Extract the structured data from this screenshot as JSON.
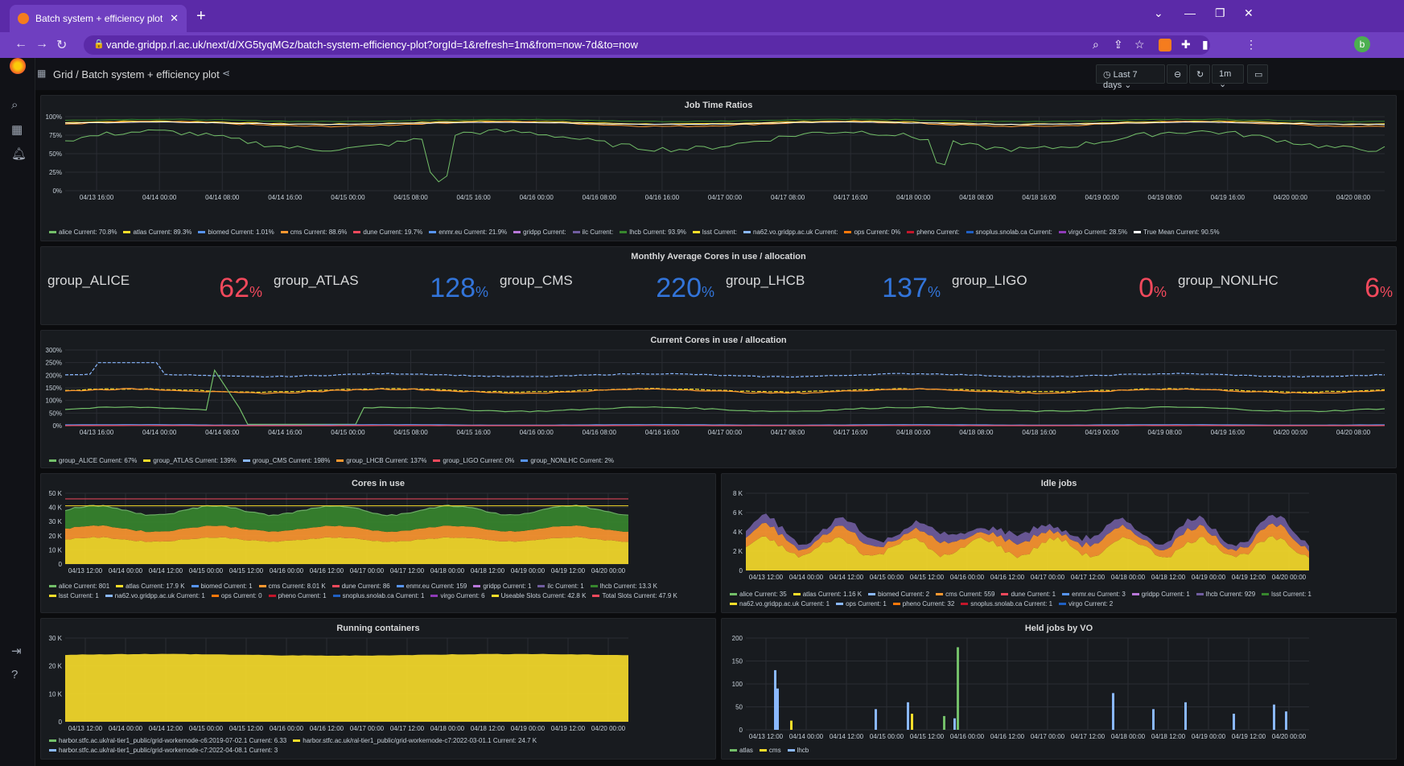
{
  "browser": {
    "tab_title": "Batch system + efficiency plot - G",
    "tab_close": "✕",
    "new_tab": "+",
    "url": "vande.gridpp.rl.ac.uk/next/d/XG5tyqMGz/batch-system-efficiency-plot?orgId=1&refresh=1m&from=now-7d&to=now",
    "profile_initial": "b"
  },
  "header": {
    "breadcrumb": "Grid  /  Batch system + efficiency plot",
    "time_range": "Last 7 days",
    "refresh": "1m"
  },
  "panels": {
    "job_time_ratios": {
      "title": "Job Time Ratios",
      "y_ticks": [
        "100%",
        "75%",
        "50%",
        "25%",
        "0%"
      ],
      "x_ticks": [
        "04/13 16:00",
        "04/14 00:00",
        "04/14 08:00",
        "04/14 16:00",
        "04/15 00:00",
        "04/15 08:00",
        "04/15 16:00",
        "04/16 00:00",
        "04/16 08:00",
        "04/16 16:00",
        "04/17 00:00",
        "04/17 08:00",
        "04/17 16:00",
        "04/18 00:00",
        "04/18 08:00",
        "04/18 16:00",
        "04/19 00:00",
        "04/19 08:00",
        "04/19 16:00",
        "04/20 00:00",
        "04/20 08:00"
      ],
      "legend": [
        {
          "text": "alice  Current: 70.8%",
          "color": "#73bf69"
        },
        {
          "text": "atlas  Current: 89.3%",
          "color": "#fade2a"
        },
        {
          "text": "biomed  Current: 1.01%",
          "color": "#5794f2"
        },
        {
          "text": "cms  Current: 88.6%",
          "color": "#ff9830"
        },
        {
          "text": "dune  Current: 19.7%",
          "color": "#f2495c"
        },
        {
          "text": "enmr.eu  Current: 21.9%",
          "color": "#5794f2"
        },
        {
          "text": "gridpp  Current:",
          "color": "#b877d9"
        },
        {
          "text": "ilc  Current:",
          "color": "#705da0"
        },
        {
          "text": "lhcb  Current: 93.9%",
          "color": "#37872d"
        },
        {
          "text": "lsst  Current:",
          "color": "#fade2a"
        },
        {
          "text": "na62.vo.gridpp.ac.uk  Current:",
          "color": "#8ab8ff"
        },
        {
          "text": "ops  Current: 0%",
          "color": "#ff780a"
        },
        {
          "text": "pheno  Current:",
          "color": "#c4162a"
        },
        {
          "text": "snoplus.snolab.ca  Current:",
          "color": "#1f60c4"
        },
        {
          "text": "virgo  Current: 28.5%",
          "color": "#8f3bb8"
        },
        {
          "text": "True Mean  Current: 90.5%",
          "color": "#ffffff"
        }
      ]
    },
    "monthly_avg": {
      "title": "Monthly Average Cores in use / allocation",
      "stats": [
        {
          "name": "group_ALICE",
          "value": "62",
          "unit": "%",
          "color": "#f2495c"
        },
        {
          "name": "group_ATLAS",
          "value": "128",
          "unit": "%",
          "color": "#3274d9"
        },
        {
          "name": "group_CMS",
          "value": "220",
          "unit": "%",
          "color": "#3274d9"
        },
        {
          "name": "group_LHCB",
          "value": "137",
          "unit": "%",
          "color": "#3274d9"
        },
        {
          "name": "group_LIGO",
          "value": "0",
          "unit": "%",
          "color": "#f2495c"
        },
        {
          "name": "group_NONLHC",
          "value": "6",
          "unit": "%",
          "color": "#f2495c"
        }
      ]
    },
    "current_cores": {
      "title": "Current Cores in use / allocation",
      "y_ticks": [
        "300%",
        "250%",
        "200%",
        "150%",
        "100%",
        "50%",
        "0%"
      ],
      "x_ticks": [
        "04/13 16:00",
        "04/14 00:00",
        "04/14 08:00",
        "04/14 16:00",
        "04/15 00:00",
        "04/15 08:00",
        "04/15 16:00",
        "04/16 00:00",
        "04/16 08:00",
        "04/16 16:00",
        "04/17 00:00",
        "04/17 08:00",
        "04/17 16:00",
        "04/18 00:00",
        "04/18 08:00",
        "04/18 16:00",
        "04/19 00:00",
        "04/19 08:00",
        "04/19 16:00",
        "04/20 00:00",
        "04/20 08:00"
      ],
      "legend": [
        {
          "text": "group_ALICE  Current: 67%",
          "color": "#73bf69"
        },
        {
          "text": "group_ATLAS  Current: 139%",
          "color": "#fade2a"
        },
        {
          "text": "group_CMS  Current: 198%",
          "color": "#8ab8ff"
        },
        {
          "text": "group_LHCB  Current: 137%",
          "color": "#ff9830"
        },
        {
          "text": "group_LIGO  Current: 0%",
          "color": "#f2495c"
        },
        {
          "text": "group_NONLHC  Current: 2%",
          "color": "#5794f2"
        }
      ]
    },
    "cores_in_use": {
      "title": "Cores in use",
      "y_ticks": [
        "50 K",
        "40 K",
        "30 K",
        "20 K",
        "10 K",
        "0"
      ],
      "x_ticks": [
        "04/13 12:00",
        "04/14 00:00",
        "04/14 12:00",
        "04/15 00:00",
        "04/15 12:00",
        "04/16 00:00",
        "04/16 12:00",
        "04/17 00:00",
        "04/17 12:00",
        "04/18 00:00",
        "04/18 12:00",
        "04/19 00:00",
        "04/19 12:00",
        "04/20 00:00"
      ],
      "legend": [
        {
          "text": "alice  Current: 801",
          "color": "#73bf69"
        },
        {
          "text": "atlas  Current: 17.9 K",
          "color": "#fade2a"
        },
        {
          "text": "biomed  Current: 1",
          "color": "#5794f2"
        },
        {
          "text": "cms  Current: 8.01 K",
          "color": "#ff9830"
        },
        {
          "text": "dune  Current: 86",
          "color": "#f2495c"
        },
        {
          "text": "enmr.eu  Current: 159",
          "color": "#5794f2"
        },
        {
          "text": "gridpp  Current: 1",
          "color": "#b877d9"
        },
        {
          "text": "ilc  Current: 1",
          "color": "#705da0"
        },
        {
          "text": "lhcb  Current: 13.3 K",
          "color": "#37872d"
        },
        {
          "text": "lsst  Current: 1",
          "color": "#fade2a"
        },
        {
          "text": "na62.vo.gridpp.ac.uk  Current: 1",
          "color": "#8ab8ff"
        },
        {
          "text": "ops  Current: 0",
          "color": "#ff780a"
        },
        {
          "text": "pheno  Current: 1",
          "color": "#c4162a"
        },
        {
          "text": "snoplus.snolab.ca  Current: 1",
          "color": "#1f60c4"
        },
        {
          "text": "virgo  Current: 6",
          "color": "#8f3bb8"
        },
        {
          "text": "Useable Slots  Current: 42.8 K",
          "color": "#fade2a"
        },
        {
          "text": "Total Slots  Current: 47.9 K",
          "color": "#f2495c"
        }
      ]
    },
    "idle_jobs": {
      "title": "Idle jobs",
      "y_ticks": [
        "8 K",
        "6 K",
        "4 K",
        "2 K",
        "0"
      ],
      "x_ticks": [
        "04/13 12:00",
        "04/14 00:00",
        "04/14 12:00",
        "04/15 00:00",
        "04/15 12:00",
        "04/16 00:00",
        "04/16 12:00",
        "04/17 00:00",
        "04/17 12:00",
        "04/18 00:00",
        "04/18 12:00",
        "04/19 00:00",
        "04/19 12:00",
        "04/20 00:00"
      ],
      "legend": [
        {
          "text": "alice  Current: 35",
          "color": "#73bf69"
        },
        {
          "text": "atlas  Current: 1.16 K",
          "color": "#fade2a"
        },
        {
          "text": "biomed  Current: 2",
          "color": "#8ab8ff"
        },
        {
          "text": "cms  Current: 559",
          "color": "#ff9830"
        },
        {
          "text": "dune  Current: 1",
          "color": "#f2495c"
        },
        {
          "text": "enmr.eu  Current: 3",
          "color": "#5794f2"
        },
        {
          "text": "gridpp  Current: 1",
          "color": "#b877d9"
        },
        {
          "text": "lhcb  Current: 929",
          "color": "#705da0"
        },
        {
          "text": "lsst  Current: 1",
          "color": "#37872d"
        },
        {
          "text": "na62.vo.gridpp.ac.uk  Current: 1",
          "color": "#fade2a"
        },
        {
          "text": "ops  Current: 1",
          "color": "#8ab8ff"
        },
        {
          "text": "pheno  Current: 32",
          "color": "#ff780a"
        },
        {
          "text": "snoplus.snolab.ca  Current: 1",
          "color": "#c4162a"
        },
        {
          "text": "virgo  Current: 2",
          "color": "#1f60c4"
        }
      ]
    },
    "running_containers": {
      "title": "Running containers",
      "y_ticks": [
        "30 K",
        "20 K",
        "10 K",
        "0"
      ],
      "x_ticks": [
        "04/13 12:00",
        "04/14 00:00",
        "04/14 12:00",
        "04/15 00:00",
        "04/15 12:00",
        "04/16 00:00",
        "04/16 12:00",
        "04/17 00:00",
        "04/17 12:00",
        "04/18 00:00",
        "04/18 12:00",
        "04/19 00:00",
        "04/19 12:00",
        "04/20 00:00"
      ],
      "legend": [
        {
          "text": "harbor.stfc.ac.uk/ral-tier1_public/grid-workernode-c6:2019-07-02.1  Current: 6.33",
          "color": "#73bf69"
        },
        {
          "text": "harbor.stfc.ac.uk/ral-tier1_public/grid-workernode-c7:2022-03-01.1  Current: 24.7 K",
          "color": "#fade2a"
        },
        {
          "text": "harbor.stfc.ac.uk/ral-tier1_public/grid-workernode-c7:2022-04-08.1  Current: 3",
          "color": "#8ab8ff"
        }
      ]
    },
    "held_jobs": {
      "title": "Held jobs by VO",
      "y_ticks": [
        "200",
        "150",
        "100",
        "50",
        "0"
      ],
      "x_ticks": [
        "04/13 12:00",
        "04/14 00:00",
        "04/14 12:00",
        "04/15 00:00",
        "04/15 12:00",
        "04/16 00:00",
        "04/16 12:00",
        "04/17 00:00",
        "04/17 12:00",
        "04/18 00:00",
        "04/18 12:00",
        "04/19 00:00",
        "04/19 12:00",
        "04/20 00:00"
      ],
      "legend": [
        {
          "text": "atlas",
          "color": "#73bf69"
        },
        {
          "text": "cms",
          "color": "#fade2a"
        },
        {
          "text": "lhcb",
          "color": "#8ab8ff"
        }
      ]
    }
  }
}
